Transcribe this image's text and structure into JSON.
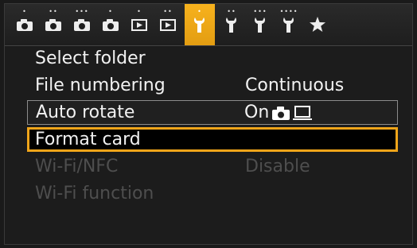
{
  "tabs": [
    {
      "icon": "camera-icon",
      "dots": "•",
      "active": false
    },
    {
      "icon": "camera-icon",
      "dots": "••",
      "active": false
    },
    {
      "icon": "camera-icon",
      "dots": "•••",
      "active": false
    },
    {
      "icon": "camera-icon",
      "dots": "•",
      "active": false
    },
    {
      "icon": "playback-icon",
      "dots": "•",
      "active": false
    },
    {
      "icon": "playback-icon",
      "dots": "••",
      "active": false
    },
    {
      "icon": "wrench-icon",
      "dots": "•",
      "active": true
    },
    {
      "icon": "wrench-icon",
      "dots": "••",
      "active": false
    },
    {
      "icon": "wrench-icon",
      "dots": "•••",
      "active": false
    },
    {
      "icon": "wrench-icon",
      "dots": "••••",
      "active": false
    },
    {
      "icon": "star-icon",
      "dots": "",
      "active": false
    }
  ],
  "menu": {
    "select_folder": {
      "label": "Select folder"
    },
    "file_numbering": {
      "label": "File numbering",
      "value": "Continuous"
    },
    "auto_rotate": {
      "label": "Auto rotate",
      "value": "On"
    },
    "format_card": {
      "label": "Format card"
    },
    "wifi_nfc": {
      "label": "Wi-Fi/NFC",
      "value": "Disable"
    },
    "wifi_function": {
      "label": "Wi-Fi function"
    }
  },
  "colors": {
    "accent": "#f0a51a",
    "text": "#f2f2f2",
    "disabled": "#4e4e4e"
  }
}
